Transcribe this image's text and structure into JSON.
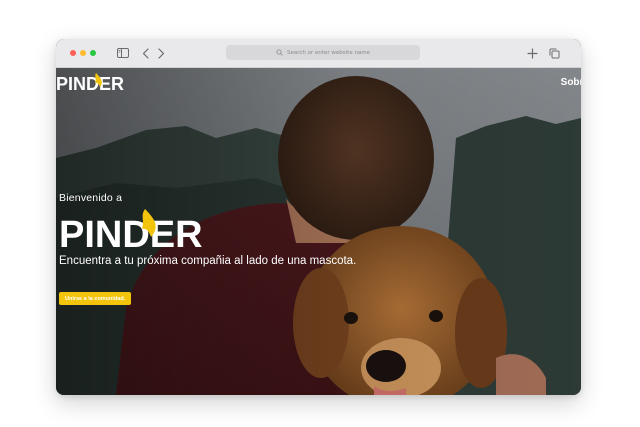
{
  "browser": {
    "address_placeholder": "Search or enter website name"
  },
  "nav": {
    "logo": "PINDER",
    "about_label": "Sobre"
  },
  "hero": {
    "welcome": "Bienvenido a",
    "logo": "PINDER",
    "tagline": "Encuentra a tu próxima compañia al lado de una mascota.",
    "cta_label": "Unirse a la comunidad."
  },
  "colors": {
    "accent": "#f2c40b",
    "text": "#ffffff"
  }
}
